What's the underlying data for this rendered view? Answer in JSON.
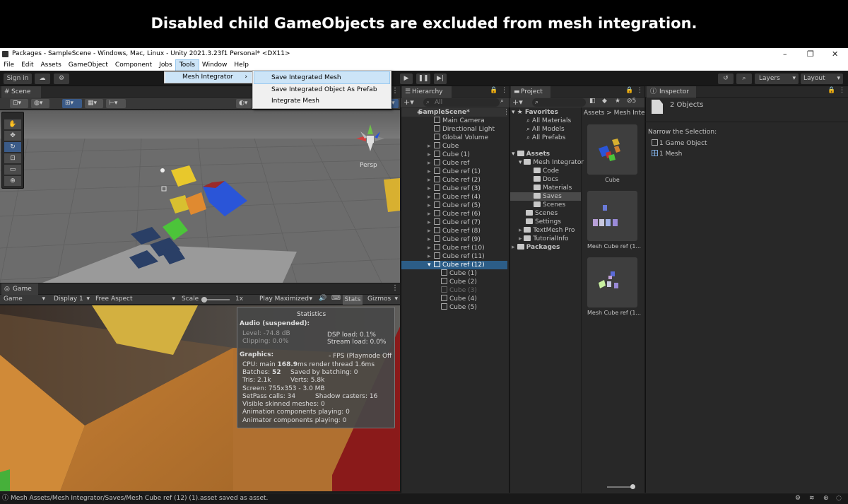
{
  "banner": "Disabled child GameObjects are excluded from mesh integration.",
  "window": {
    "title": "Packages - SampleScene - Windows, Mac, Linux - Unity 2021.3.23f1 Personal* <DX11>"
  },
  "menubar": [
    "File",
    "Edit",
    "Assets",
    "GameObject",
    "Component",
    "Jobs",
    "Tools",
    "Window",
    "Help"
  ],
  "toolbar": {
    "sign_in": "Sign in",
    "layers": "Layers",
    "layout": "Layout"
  },
  "tools_menu": {
    "item": "Mesh Integrator",
    "arrow": "›"
  },
  "submenu": [
    "Save Integrated Mesh",
    "Save Integrated Object As Prefab",
    "Integrate Mesh"
  ],
  "scene": {
    "tab": "Scene",
    "persp": "Persp"
  },
  "game": {
    "tab": "Game",
    "mode": "Game",
    "display": "Display 1",
    "aspect": "Free Aspect",
    "scale_label": "Scale",
    "scale_value": "1x",
    "play_max": "Play Maximized",
    "stats": "Stats",
    "gizmos": "Gizmos"
  },
  "statistics": {
    "title": "Statistics",
    "audio_header": "Audio (suspended):",
    "level": "Level: -74.8 dB",
    "clipping": "Clipping: 0.0%",
    "dsp": "DSP load: 0.1%",
    "stream": "Stream load: 0.0%",
    "graphics_header": "Graphics:",
    "fps": "- FPS (Playmode Off",
    "cpu_prefix": "CPU: main ",
    "cpu_main": "168.9",
    "cpu_suffix": "ms  render thread 1.6ms",
    "batches_prefix": "Batches: ",
    "batches": "52",
    "saved_batching": "Saved by batching: 0",
    "tris": "Tris: 2.1k",
    "verts": "Verts: 5.8k",
    "screen": "Screen: 755x353 - 3.0 MB",
    "setpass": "SetPass calls: 34",
    "shadow": "Shadow casters: 16",
    "skinned": "Visible skinned meshes: 0",
    "anim_comp": "Animation components playing: 0",
    "animator_comp": "Animator components playing: 0"
  },
  "hierarchy": {
    "tab": "Hierarchy",
    "search_placeholder": "All",
    "scene": "SampleScene*",
    "items": [
      "Main Camera",
      "Directional Light",
      "Global Volume",
      "Cube",
      "Cube (1)",
      "Cube ref",
      "Cube ref (1)",
      "Cube ref (2)",
      "Cube ref (3)",
      "Cube ref (4)",
      "Cube ref (5)",
      "Cube ref (6)",
      "Cube ref (7)",
      "Cube ref (8)",
      "Cube ref (9)",
      "Cube ref (10)",
      "Cube ref (11)",
      "Cube ref (12)"
    ],
    "children": [
      "Cube (1)",
      "Cube (2)",
      "Cube (3)",
      "Cube (4)",
      "Cube (5)"
    ]
  },
  "project": {
    "tab": "Project",
    "count": "5",
    "favorites": "Favorites",
    "fav_items": [
      "All Materials",
      "All Models",
      "All Prefabs"
    ],
    "assets": "Assets",
    "mesh_integrator": "Mesh Integrator",
    "mi_children": [
      "Code",
      "Docs",
      "Materials",
      "Saves",
      "Scenes"
    ],
    "other": [
      "Scenes",
      "Settings",
      "TextMesh Pro",
      "TutorialInfo"
    ],
    "packages": "Packages",
    "breadcrumb_root": "Assets",
    "breadcrumb_sep": ">",
    "breadcrumb_child": "Mesh Integ",
    "grid": [
      "Cube",
      "Mesh Cube ref (1...",
      "Mesh Cube ref (1..."
    ]
  },
  "inspector": {
    "tab": "Inspector",
    "objects": "2 Objects",
    "narrow": "Narrow the Selection:",
    "sel1": "1 Game Object",
    "sel2": "1 Mesh"
  },
  "status": "Mesh Assets/Mesh Integrator/Saves/Mesh Cube ref (12) (1).asset saved as asset."
}
